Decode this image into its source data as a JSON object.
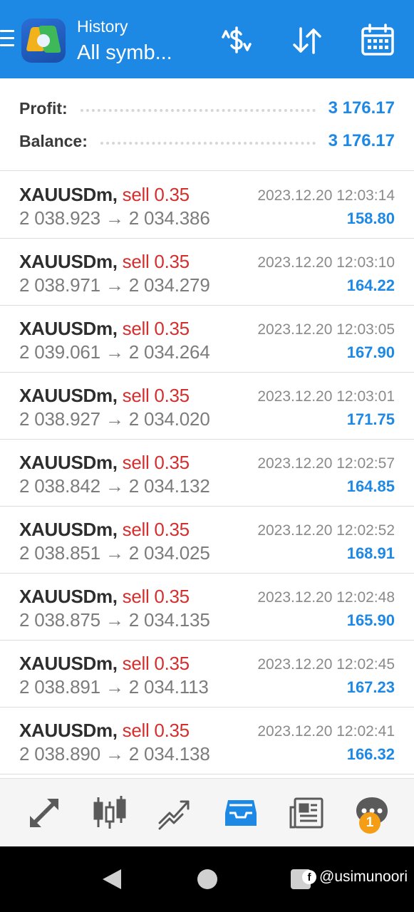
{
  "header": {
    "title_small": "History",
    "title_big": "All symb...",
    "menu_icon": "hamburger-menu-icon",
    "buttons": [
      "currency-exchange-icon",
      "sort-icon",
      "calendar-icon"
    ]
  },
  "summary": {
    "profit_label": "Profit:",
    "profit_value": "3 176.17",
    "balance_label": "Balance:",
    "balance_value": "3 176.17"
  },
  "deals": [
    {
      "symbol": "XAUUSDm,",
      "type": "sell 0.35",
      "prices": "2 038.923 → 2 034.386",
      "time": "2023.12.20 12:03:14",
      "profit": "158.80"
    },
    {
      "symbol": "XAUUSDm,",
      "type": "sell 0.35",
      "prices": "2 038.971 → 2 034.279",
      "time": "2023.12.20 12:03:10",
      "profit": "164.22"
    },
    {
      "symbol": "XAUUSDm,",
      "type": "sell 0.35",
      "prices": "2 039.061 → 2 034.264",
      "time": "2023.12.20 12:03:05",
      "profit": "167.90"
    },
    {
      "symbol": "XAUUSDm,",
      "type": "sell 0.35",
      "prices": "2 038.927 → 2 034.020",
      "time": "2023.12.20 12:03:01",
      "profit": "171.75"
    },
    {
      "symbol": "XAUUSDm,",
      "type": "sell 0.35",
      "prices": "2 038.842 → 2 034.132",
      "time": "2023.12.20 12:02:57",
      "profit": "164.85"
    },
    {
      "symbol": "XAUUSDm,",
      "type": "sell 0.35",
      "prices": "2 038.851 → 2 034.025",
      "time": "2023.12.20 12:02:52",
      "profit": "168.91"
    },
    {
      "symbol": "XAUUSDm,",
      "type": "sell 0.35",
      "prices": "2 038.875 → 2 034.135",
      "time": "2023.12.20 12:02:48",
      "profit": "165.90"
    },
    {
      "symbol": "XAUUSDm,",
      "type": "sell 0.35",
      "prices": "2 038.891 → 2 034.113",
      "time": "2023.12.20 12:02:45",
      "profit": "167.23"
    },
    {
      "symbol": "XAUUSDm,",
      "type": "sell 0.35",
      "prices": "2 038.890 → 2 034.138",
      "time": "2023.12.20 12:02:41",
      "profit": "166.32"
    }
  ],
  "tabbar": {
    "tabs": [
      "quotes-icon",
      "chart-icon",
      "trade-icon",
      "history-icon",
      "news-icon",
      "messages-icon"
    ],
    "active_tab": "history-icon",
    "messages_badge": "1"
  },
  "watermark": "@usimunoori",
  "colors": {
    "accent": "#1e88e5",
    "sell": "#d32f2f",
    "badge": "#f59d15"
  }
}
